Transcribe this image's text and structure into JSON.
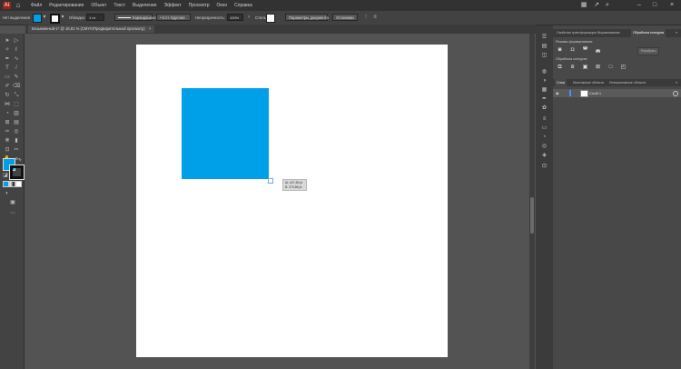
{
  "menubar": {
    "logo": "Ai",
    "items": [
      "Файл",
      "Редактирование",
      "Объект",
      "Текст",
      "Выделение",
      "Эффект",
      "Просмотр",
      "Окно",
      "Справка"
    ]
  },
  "control_bar": {
    "no_selection": "Нет выделения",
    "stroke_label": "Обводка:",
    "stroke_weight": "1 пт",
    "brush_label": "Карандашная",
    "profile_label": "5 пт. Круглая",
    "opacity_label": "Непрозрачность:",
    "opacity_value": "100%",
    "style_label": "Стиль:",
    "doc_setup_button": "Параметры документа",
    "preferences_button": "Установки"
  },
  "document_tab": {
    "title": "Безымянный-1* @ 16,81 % (CMYK/Предварительный просмотр)",
    "close": "×"
  },
  "colors": {
    "fill": "#00a0e9",
    "rect_fill": "#00a0e9",
    "artboard": "#ffffff",
    "ui_dark": "#323232",
    "ui_mid": "#434343",
    "pasteboard": "#535353"
  },
  "tooltip": {
    "width_label": "Ш: 427,69 pt",
    "height_label": "В: 373,88 pt"
  },
  "panels": {
    "tabs": [
      "Свойства трансформации",
      "Выравнивание",
      "Обработка контуров"
    ],
    "active_tab": 2,
    "shape_modes_label": "Режимы формирования:",
    "pathfinders_label": "Обработка контуров:",
    "expand_button": "Разобрать",
    "layers_tabs": [
      "Слои",
      "Монтажные области",
      "Интерактивные области"
    ],
    "layer_name": "Слой 1"
  }
}
